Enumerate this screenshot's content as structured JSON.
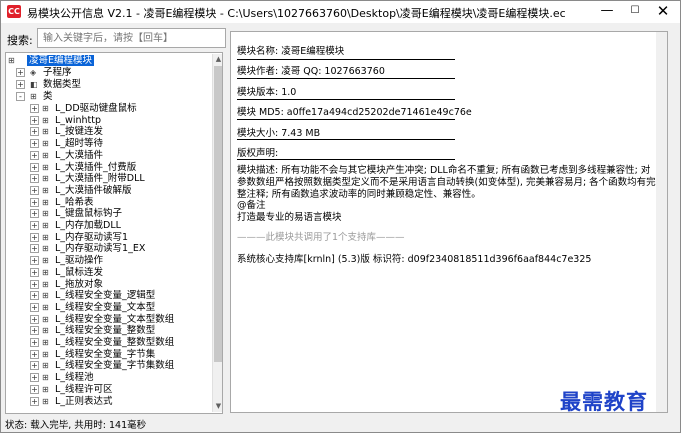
{
  "window": {
    "title": "易模块公开信息 V2.1 - 凌哥E编程模块 - C:\\Users\\1027663760\\Desktop\\凌哥E编程模块\\凌哥E编程模块.ec",
    "app_icon_text": "CC",
    "minimize": "—",
    "maximize": "☐",
    "close": "✕"
  },
  "search": {
    "label": "搜索:",
    "placeholder": "输入关键字后，请按【回车】"
  },
  "tree": {
    "root": "凌哥E编程模块",
    "sections": [
      {
        "label": "子程序",
        "expander": "+"
      },
      {
        "label": "数据类型",
        "expander": "+"
      },
      {
        "label": "类",
        "expander": "-"
      }
    ],
    "classes": [
      "L_DD驱动键盘鼠标",
      "L_winhttp",
      "L_按键连发",
      "L_超时等待",
      "L_大漠插件",
      "L_大漠插件_付费版",
      "L_大漠插件_附带DLL",
      "L_大漠插件破解版",
      "L_哈希表",
      "L_键盘鼠标钩子",
      "L_内存加载DLL",
      "L_内存驱动读写1",
      "L_内存驱动读写1_EX",
      "L_驱动操作",
      "L_鼠标连发",
      "L_拖放对象",
      "L_线程安全变量_逻辑型",
      "L_线程安全变量_文本型",
      "L_线程安全变量_文本型数组",
      "L_线程安全变量_整数型",
      "L_线程安全变量_整数型数组",
      "L_线程安全变量_字节集",
      "L_线程安全变量_字节集数组",
      "L_线程池",
      "L_线程许可区",
      "L_正则表达式"
    ],
    "scroll_up": "▲",
    "scroll_down": "▼"
  },
  "detail": {
    "name": "模块名称: 凌哥E编程模块",
    "author": "模块作者: 凌哥 QQ: 1027663760",
    "version": "模块版本: 1.0",
    "md5": "模块 MD5: a0ffe17a494cd25202de71461e49c76e",
    "size": "模块大小: 7.43 MB",
    "copyright": "版权声明:",
    "description": "模块描述: 所有功能不会与其它模块产生冲突; DLL命名不重复; 所有函数已考虑到多线程兼容性; 对参数数组严格按照数据类型定义而不是采用语言自动转换(如变体型), 完美兼容易月; 各个函数均有完整注释; 所有函数追求波动率的同时兼顾稳定性、兼容性。",
    "note": "@备注",
    "tagline": "打造最专业的易语言模块",
    "dependency": "———此模块共调用了1个支持库———",
    "support_lib": "系统核心支持库[krnln] (5.3)版  标识符: d09f2340818511d396f6aaf844c7e325"
  },
  "status": {
    "text": "状态: 载入完毕, 共用时: 141毫秒"
  },
  "watermark": {
    "text": "最需教育"
  }
}
